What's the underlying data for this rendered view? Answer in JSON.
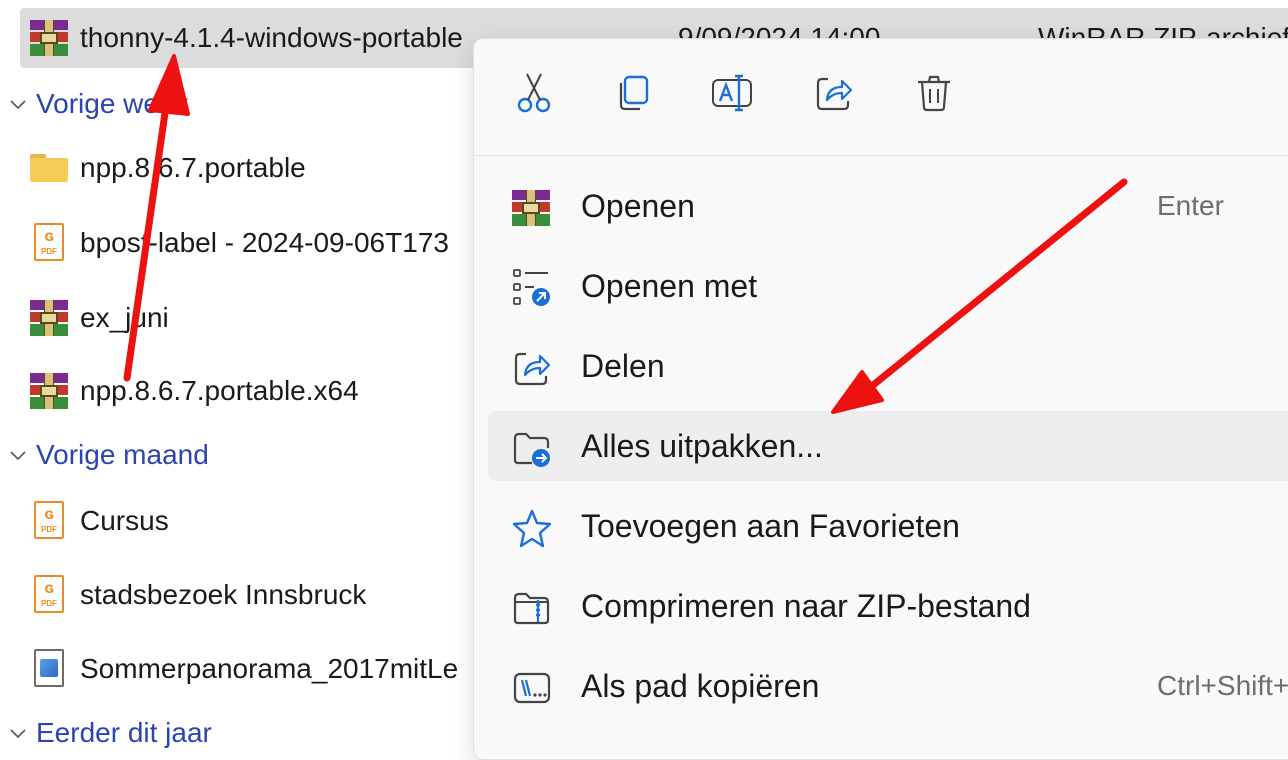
{
  "file_list": {
    "selected_row": {
      "name": "thonny-4.1.4-windows-portable",
      "date": "9/09/2024 14:00",
      "type": "WinRAR ZIP-archief",
      "icon": "winrar-icon"
    },
    "groups": [
      {
        "title": "Vorige week",
        "items": [
          {
            "name": "npp.8.6.7.portable",
            "icon": "folder-icon"
          },
          {
            "name": "bpost-label - 2024-09-06T173",
            "icon": "pdf-icon"
          },
          {
            "name": "ex_juni",
            "icon": "winrar-icon"
          },
          {
            "name": "npp.8.6.7.portable.x64",
            "icon": "winrar-icon"
          }
        ]
      },
      {
        "title": "Vorige maand",
        "items": [
          {
            "name": "Cursus",
            "icon": "pdf-icon"
          },
          {
            "name": "stadsbezoek Innsbruck",
            "icon": "pdf-icon"
          },
          {
            "name": "Sommerpanorama_2017mitLe",
            "icon": "image-icon"
          }
        ]
      },
      {
        "title": "Eerder dit jaar",
        "items": []
      }
    ]
  },
  "context_menu": {
    "quick_actions": [
      {
        "name": "cut-icon"
      },
      {
        "name": "copy-icon"
      },
      {
        "name": "rename-icon"
      },
      {
        "name": "share-icon"
      },
      {
        "name": "delete-icon"
      }
    ],
    "items": [
      {
        "label": "Openen",
        "shortcut": "Enter",
        "icon": "winrar-icon"
      },
      {
        "label": "Openen met",
        "shortcut": "",
        "icon": "open-with-icon"
      },
      {
        "label": "Delen",
        "shortcut": "",
        "icon": "share-icon"
      },
      {
        "label": "Alles uitpakken...",
        "shortcut": "",
        "icon": "extract-all-icon",
        "highlighted": true
      },
      {
        "label": "Toevoegen aan Favorieten",
        "shortcut": "",
        "icon": "star-icon"
      },
      {
        "label": "Comprimeren naar ZIP-bestand",
        "shortcut": "",
        "icon": "zip-folder-icon"
      },
      {
        "label": "Als pad kopiëren",
        "shortcut": "Ctrl+Shift+C",
        "icon": "copy-path-icon"
      }
    ]
  },
  "colors": {
    "group_title": "#2a44b0",
    "annotation_arrow": "#ee1111",
    "accent_icon": "#1a6fd6"
  }
}
